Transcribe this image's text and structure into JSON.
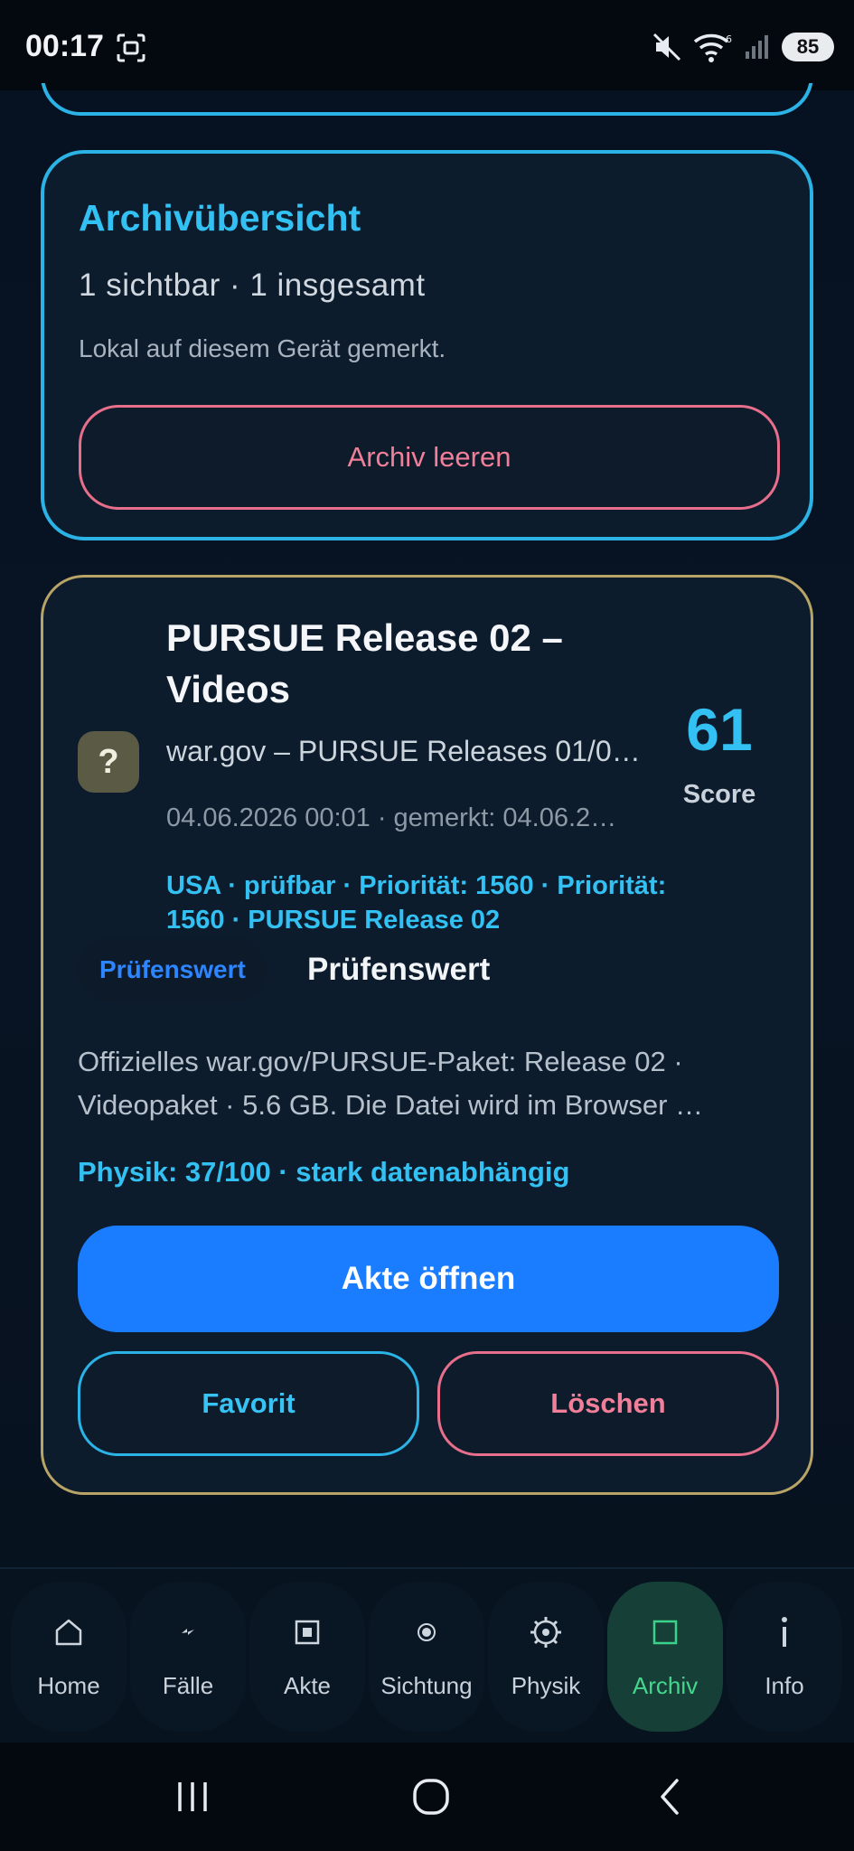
{
  "status_bar": {
    "time": "00:17",
    "battery": "85",
    "icons": [
      "screenshot-icon",
      "mute-icon",
      "wifi-icon",
      "signal-icon"
    ]
  },
  "overview": {
    "title": "Archivübersicht",
    "count": "1 sichtbar · 1 insgesamt",
    "note": "Lokal auf diesem Gerät gemerkt.",
    "clear_label": "Archiv leeren"
  },
  "item": {
    "icon_char": "?",
    "title": "PURSUE Release 02 – Videos",
    "source": "war.gov – PURSUE Releases 01/0…",
    "date": "04.06.2026 00:01 · gemerkt: 04.06.2…",
    "tags": "USA · prüfbar · Priorität: 1560 · Priorität: 1560 · PURSUE Release 02",
    "score_value": "61",
    "score_label": "Score",
    "rating_chip": "Prüfenswert",
    "rating_text": "Prüfenswert",
    "description_line1": "Offizielles war.gov/PURSUE-Paket: Release 02 ·",
    "description_line2": "Videopaket · 5.6 GB. Die Datei wird im Browser …",
    "physics": "Physik: 37/100 · stark datenabhängig",
    "open_label": "Akte öffnen",
    "favorite_label": "Favorit",
    "delete_label": "Löschen"
  },
  "bottom_nav": {
    "items": [
      {
        "label": "Home",
        "icon": "home-icon"
      },
      {
        "label": "Fälle",
        "icon": "bolt-icon"
      },
      {
        "label": "Akte",
        "icon": "file-square-icon"
      },
      {
        "label": "Sichtung",
        "icon": "target-icon"
      },
      {
        "label": "Physik",
        "icon": "atom-gear-icon"
      },
      {
        "label": "Archiv",
        "icon": "archive-square-icon",
        "active": true
      },
      {
        "label": "Info",
        "icon": "info-icon"
      }
    ]
  },
  "colors": {
    "accent_cyan": "#33c0f2",
    "primary_blue": "#1a7cff",
    "danger_pink": "#f17f99",
    "active_green": "#45d68e",
    "item_border_gold": "#b8a466"
  }
}
